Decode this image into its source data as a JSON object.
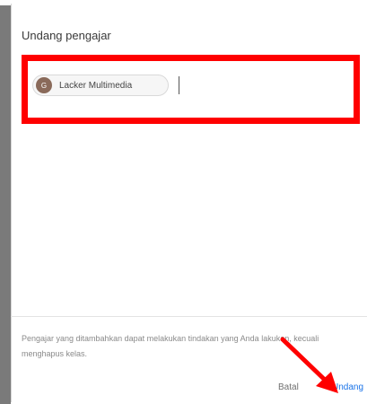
{
  "dialog": {
    "title": "Undang pengajar",
    "chip": {
      "avatar_initial": "G",
      "label": "Lacker Multimedia",
      "avatar_icon": "avatar-icon"
    },
    "note": "Pengajar yang ditambahkan dapat melakukan tindakan yang Anda lakukan, kecuali menghapus kelas.",
    "cancel_label": "Batal",
    "invite_label": "Undang"
  },
  "annotation": {
    "highlight_color": "#ff0000",
    "arrow_color": "#ff0000"
  }
}
